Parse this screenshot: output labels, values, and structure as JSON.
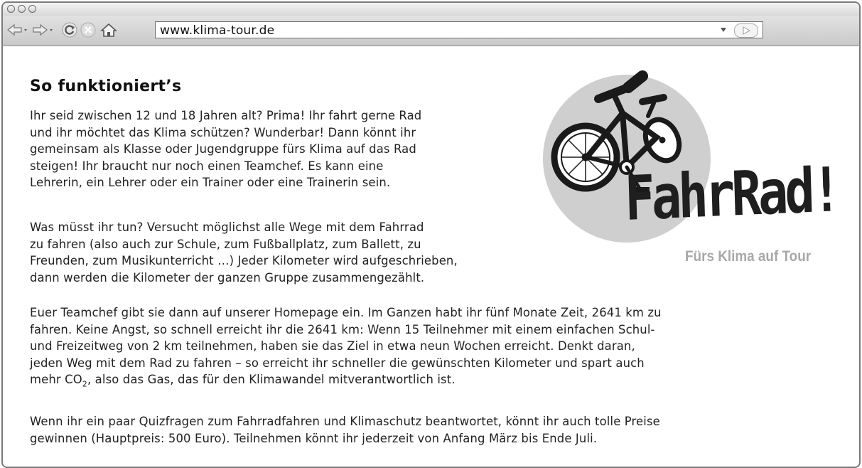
{
  "browser": {
    "url": "www.klima-tour.de",
    "icons": [
      "back-arrow-icon",
      "forward-arrow-icon",
      "reload-icon",
      "stop-icon",
      "home-icon",
      "dropdown-icon",
      "go-icon"
    ]
  },
  "page": {
    "title": "So funktioniert’s",
    "paragraph1": [
      "Ihr seid zwischen 12 und 18 Jahren alt? Prima! Ihr fahrt gerne Rad",
      "und ihr möchtet das Klima schützen? Wunderbar! Dann könnt ihr",
      "gemeinsam als Klasse oder Jugendgruppe fürs Klima auf das Rad",
      "steigen! Ihr braucht nur noch einen Teamchef. Es kann eine",
      "Lehrerin, ein Lehrer oder ein Trainer oder eine Trainerin sein."
    ],
    "paragraph2": [
      "Was müsst ihr tun? Versucht möglichst alle Wege mit dem Fahrrad",
      "zu fahren (also auch zur Schule, zum Fußballplatz, zum Ballett, zu",
      "Freunden, zum Musikunterricht …) Jeder Kilometer wird aufgeschrieben,",
      "dann werden die Kilometer der ganzen Gruppe zusammengezählt."
    ],
    "paragraph3": [
      "Euer Teamchef gibt sie dann auf unserer Homepage ein. Im Ganzen habt ihr fünf Monate Zeit, 2641 km zu",
      "fahren. Keine Angst, so schnell erreicht ihr die 2641 km: Wenn 15 Teilnehmer mit einem einfachen Schul-",
      "und Freizeitweg von 2 km teilnehmen, haben sie das Ziel in etwa neun Wochen erreicht. Denkt daran,",
      "jeden Weg mit dem Rad zu fahren – so erreicht ihr schneller die gewünschten Kilometer und spart auch"
    ],
    "paragraph3_last": {
      "before": "mehr CO",
      "sub": "2",
      "after": ", also das Gas, das für den Klimawandel mitverantwortlich ist."
    },
    "paragraph4": [
      "Wenn ihr ein paar Quizfragen zum Fahrradfahren und Klimaschutz beantwortet, könnt ihr auch tolle Preise",
      "gewinnen (Hauptpreis: 500 Euro). Teilnehmen könnt ihr jederzeit von Anfang März bis Ende Juli."
    ]
  },
  "logo": {
    "wordmark": "FahrRad!",
    "tagline": "Fürs Klima auf Tour"
  }
}
